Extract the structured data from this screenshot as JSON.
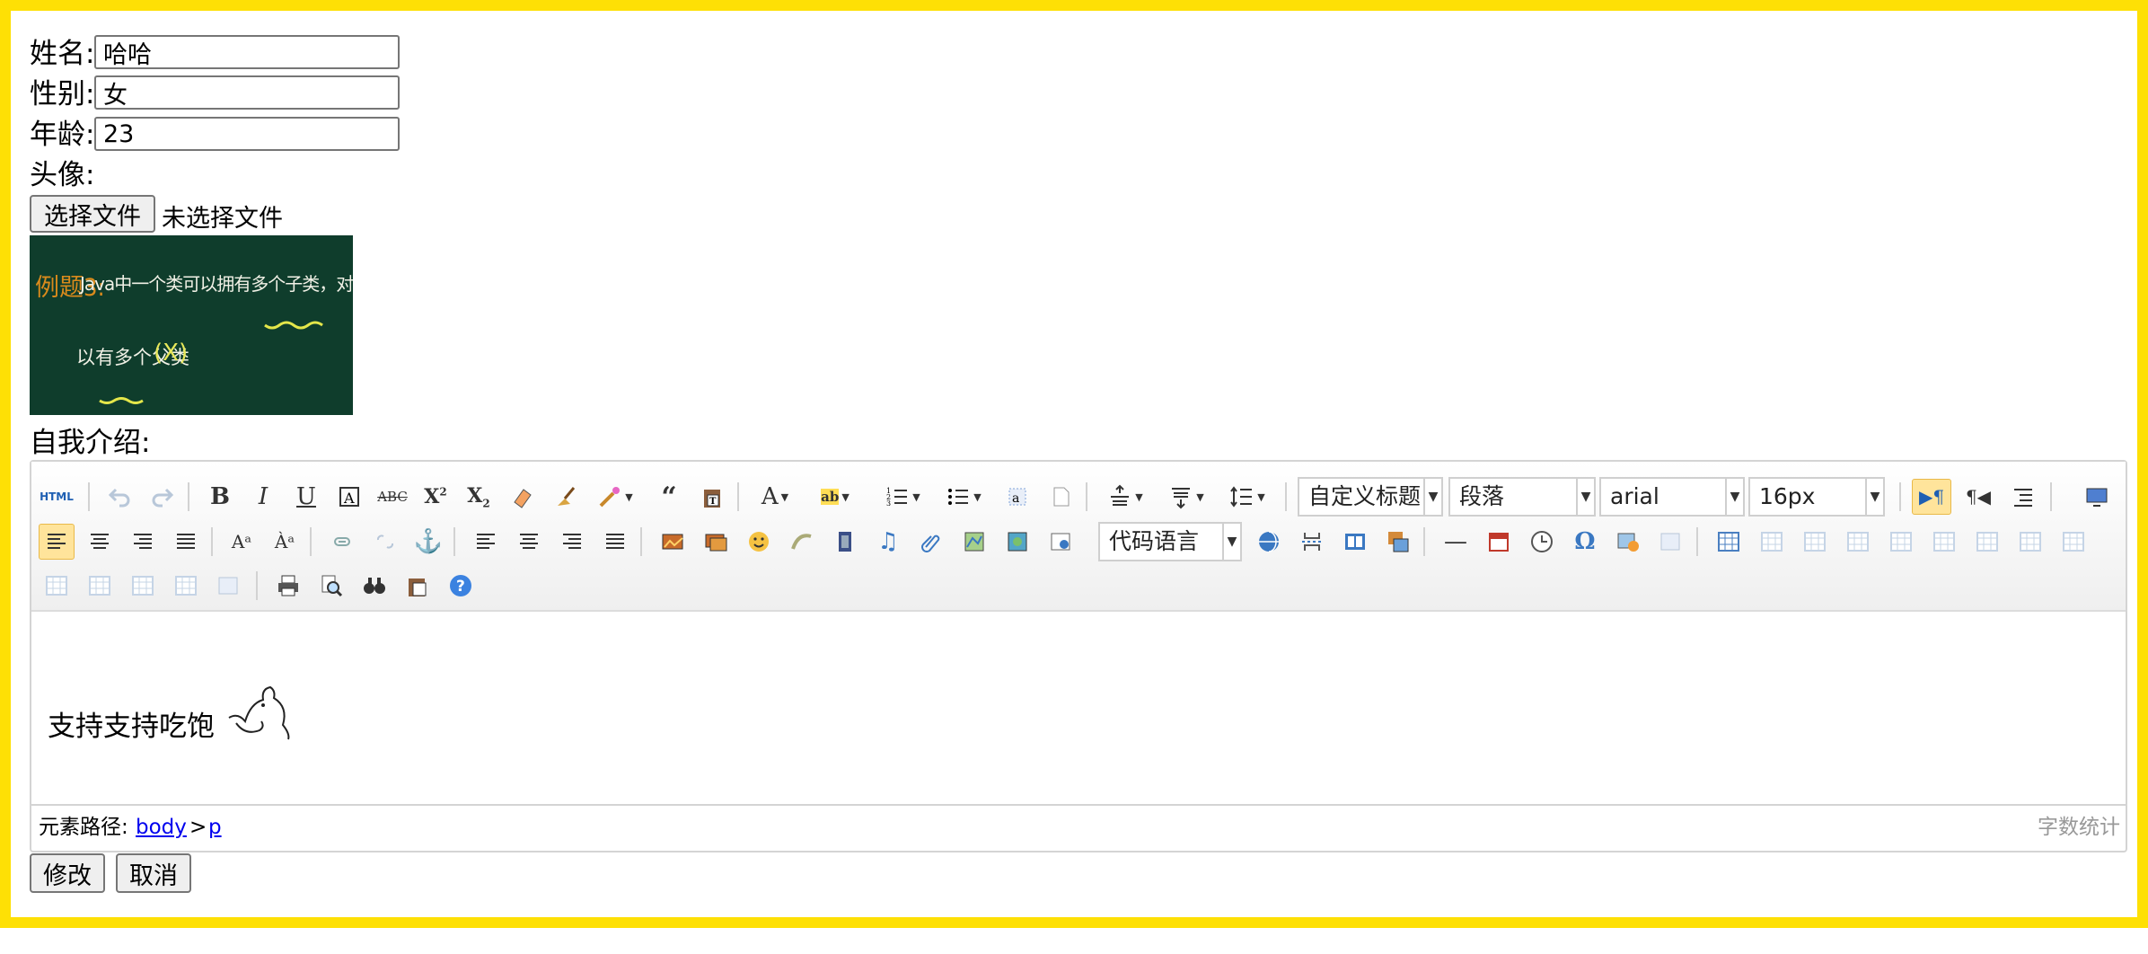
{
  "form": {
    "name_label": "姓名:",
    "name_value": "哈哈",
    "gender_label": "性别:",
    "gender_value": "女",
    "age_label": "年龄:",
    "age_value": "23",
    "avatar_label": "头像:",
    "file_button": "选择文件",
    "file_status": "未选择文件",
    "intro_label": "自我介绍:"
  },
  "avatar_image": {
    "line1_prefix": "例题3:",
    "line1": "Java中一个类可以拥有多个子类，对于一个子类也可",
    "line2": "以有多个父类",
    "mark": "(X)"
  },
  "editor": {
    "combos": {
      "heading": "自定义标题",
      "paragraph": "段落",
      "font": "arial",
      "size": "16px",
      "code": "代码语言"
    },
    "content_text": "支持支持吃饱",
    "status_path_label": "元素路径:",
    "path_body": "body",
    "path_sep": ">",
    "path_p": "p",
    "word_count": "字数统计"
  },
  "actions": {
    "modify": "修改",
    "cancel": "取消"
  },
  "colors": {
    "frame_border": "#fee005",
    "toolbar_active": "#ffe49b",
    "link": "#0000ee"
  }
}
